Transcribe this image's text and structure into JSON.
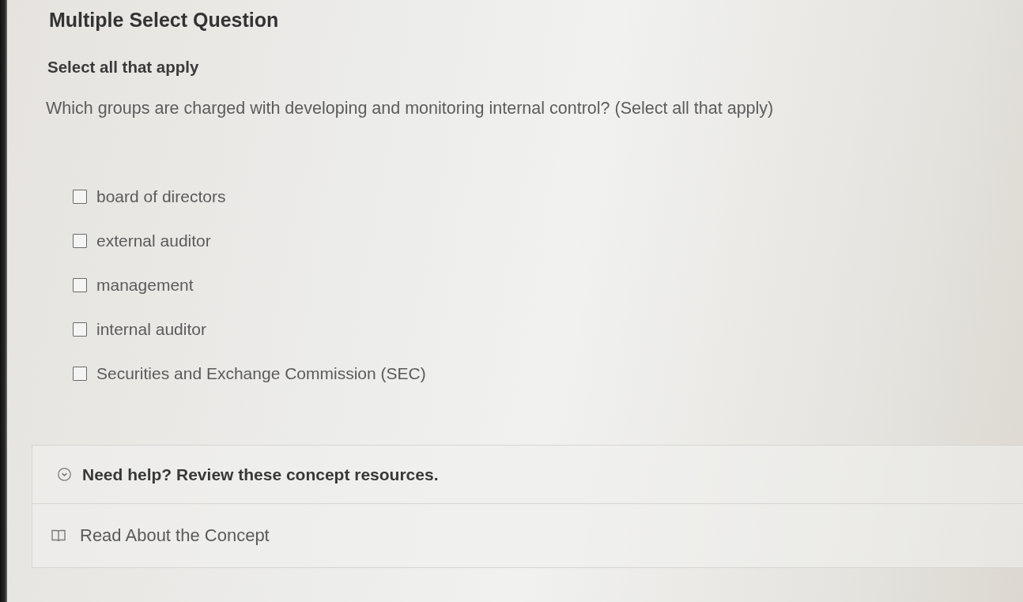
{
  "question": {
    "type_label": "Multiple Select Question",
    "instruction": "Select all that apply",
    "prompt": "Which groups are charged with developing and monitoring internal control? (Select all that apply)"
  },
  "options": [
    {
      "label": "board of directors",
      "checked": false
    },
    {
      "label": "external auditor",
      "checked": false
    },
    {
      "label": "management",
      "checked": false
    },
    {
      "label": "internal auditor",
      "checked": false
    },
    {
      "label": "Securities and Exchange Commission (SEC)",
      "checked": false
    }
  ],
  "help": {
    "title": "Need help? Review these concept resources.",
    "expanded": true,
    "resources": [
      {
        "label": "Read About the Concept"
      }
    ]
  }
}
